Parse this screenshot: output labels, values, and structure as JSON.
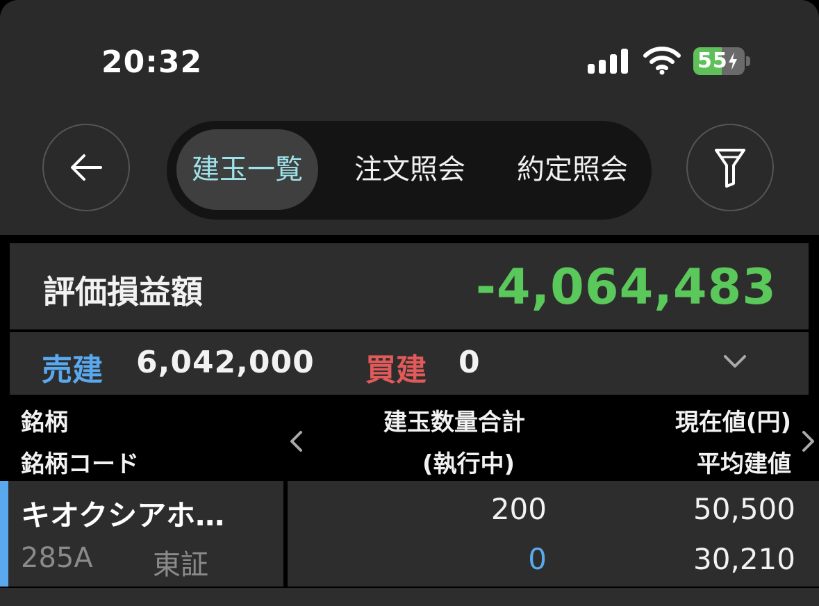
{
  "status_bar": {
    "time": "20:32",
    "battery": "55",
    "battery_level": 0.55,
    "signal_icon": "cellular-signal-icon",
    "wifi_icon": "wifi-icon",
    "charging_icon": "bolt-icon"
  },
  "nav": {
    "back_icon": "back-arrow-icon",
    "filter_icon": "filter-icon",
    "tabs": [
      {
        "label": "建玉一覧",
        "active": true
      },
      {
        "label": "注文照会",
        "active": false
      },
      {
        "label": "約定照会",
        "active": false
      }
    ]
  },
  "summary": {
    "pl_label": "評価損益額",
    "pl_value": "-4,064,483",
    "sell_label": "売建",
    "sell_value": "6,042,000",
    "buy_label": "買建",
    "buy_value": "0",
    "expand_icon": "chevron-down-icon"
  },
  "table": {
    "headers": {
      "col1_line1": "銘柄",
      "col1_line2": "銘柄コード",
      "col2_line1": "建玉数量合計",
      "col2_line2": "(執行中)",
      "col3_line1": "現在値(円)",
      "col3_line2": "平均建値"
    },
    "rows": [
      {
        "name": "キオクシアホ…",
        "code": "285A",
        "market": "東証",
        "quantity": "200",
        "executing": "0",
        "current_price": "50,500",
        "avg_price": "30,210"
      }
    ]
  },
  "colors": {
    "accent_tab": "#9fe3ea",
    "loss_green": "#5ac85a",
    "sell_blue": "#5aa8ee",
    "buy_red": "#e05a5a",
    "battery_green": "#5fc05a"
  }
}
